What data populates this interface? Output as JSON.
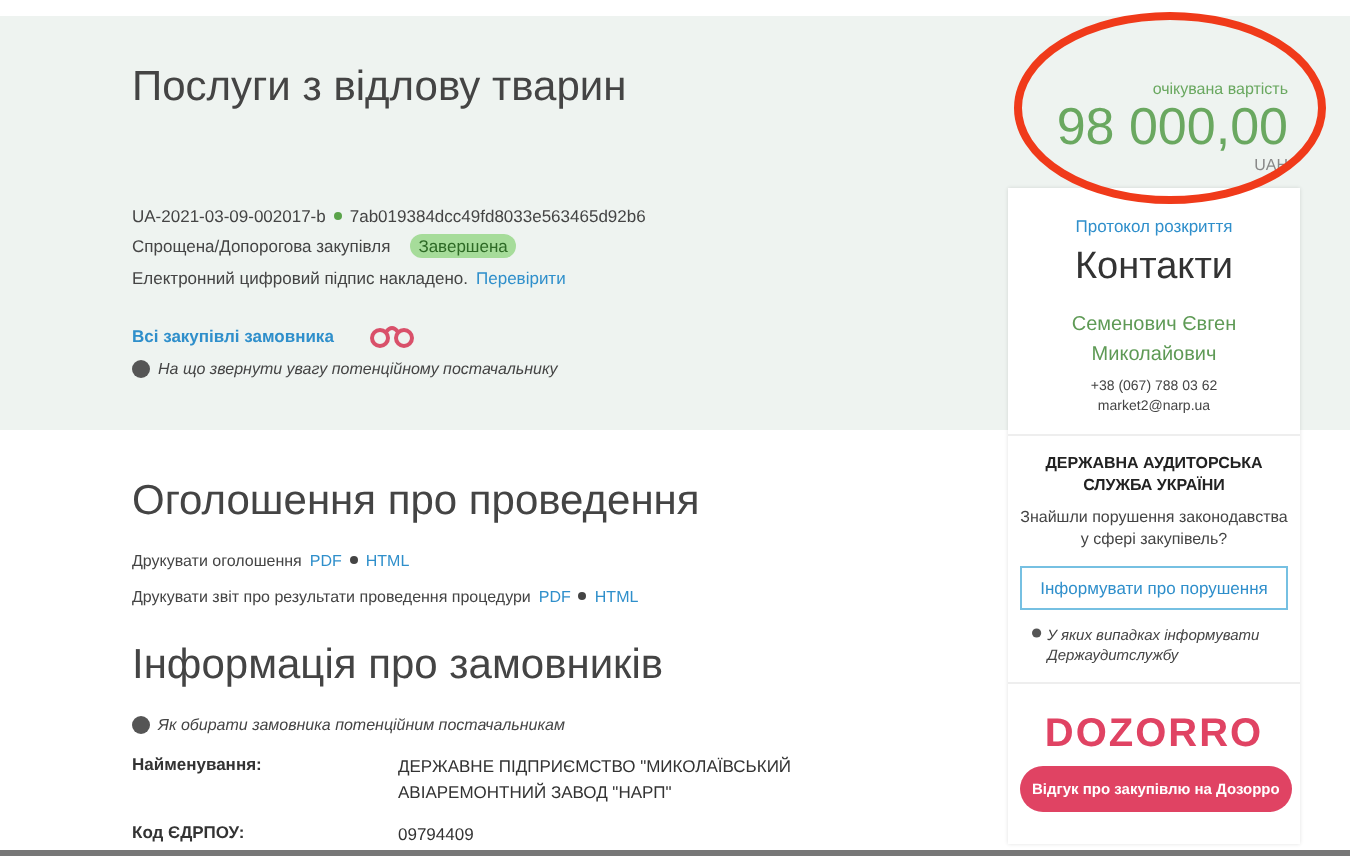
{
  "title": "Послуги з відлову тварин",
  "tender_id": "UA-2021-03-09-002017-b",
  "tender_hash": "7ab019384dcc49fd8033e563465d92b6",
  "procedure": "Спрощена/Допорогова закупівля",
  "status": {
    "label": "Завершена",
    "kind": "complete"
  },
  "signature": {
    "text": "Електронний цифровий підпис накладено.",
    "link": "Перевірити"
  },
  "all_purchases_link": "Всі закупівлі замовника",
  "supplier_hint": "На що звернути увагу потенційному постачальнику",
  "announcement": {
    "heading": "Оголошення про проведення",
    "lines": [
      {
        "text": "Друкувати оголошення",
        "links": [
          "PDF",
          "HTML"
        ]
      },
      {
        "text": "Друкувати звіт про результати проведення процедури",
        "links": [
          "PDF",
          "HTML"
        ]
      }
    ]
  },
  "customers": {
    "heading": "Інформація про замовників",
    "hint": "Як обирати замовника потенційним постачальникам",
    "rows": [
      {
        "label": "Найменування:",
        "value": "ДЕРЖАВНЕ ПІДПРИЄМСТВО \"МИКОЛАЇВСЬКИЙ АВІАРЕМОНТНИЙ ЗАВОД \"НАРП\""
      },
      {
        "label": "Код ЄДРПОУ:",
        "value": "09794409"
      }
    ]
  },
  "price": {
    "label": "очікувана вартість",
    "amount": "98 000,00",
    "currency": "UAH"
  },
  "protocol_link": "Протокол розкриття",
  "contacts": {
    "heading": "Контакти",
    "name": "Семенович Євген Миколайович",
    "phone": "+38 (067) 788 03 62",
    "email": "market2@narp.ua"
  },
  "audit": {
    "title": "ДЕРЖАВНА АУДИТОРСЬКА СЛУЖБА УКРАЇНИ",
    "question": "Знайшли порушення законодавства у сфері закупівель?",
    "button": "Інформувати про порушення",
    "hint": "У яких випадках інформувати Держаудитслужбу"
  },
  "dozorro": {
    "logo": "DOZORRO",
    "button": "Відгук про закупівлю на Дозорро"
  }
}
